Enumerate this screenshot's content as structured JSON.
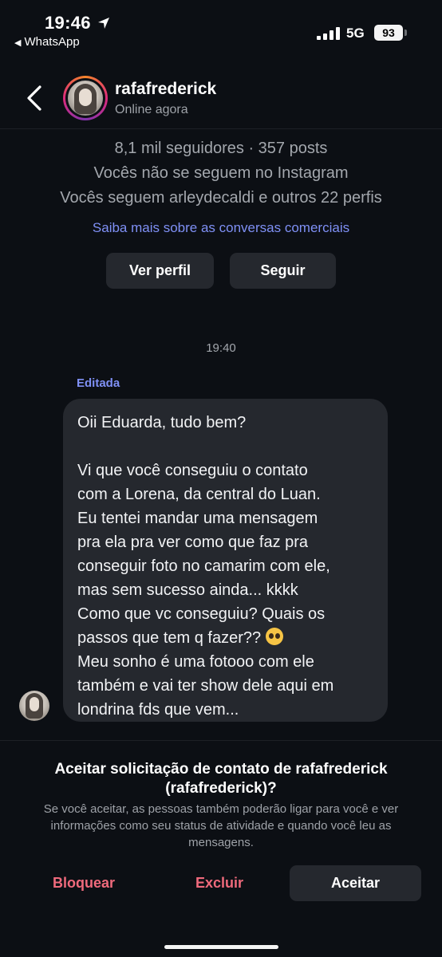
{
  "status_bar": {
    "time": "19:46",
    "back_app": "WhatsApp",
    "network": "5G",
    "battery": "93"
  },
  "header": {
    "username": "rafafrederick",
    "presence": "Online agora"
  },
  "profile_info": {
    "stats": "8,1 mil seguidores · 357 posts",
    "follow_status": "Vocês não se seguem no Instagram",
    "mutuals": "Vocês seguem arleydecaldi e outros 22 perfis",
    "learn_more": "Saiba mais sobre as conversas comerciais",
    "view_profile_label": "Ver perfil",
    "follow_label": "Seguir"
  },
  "conversation": {
    "timestamp": "19:40",
    "edited_label": "Editada",
    "message_part1": "Oii Eduarda, tudo bem?\n\nVi que você conseguiu o contato\ncom a Lorena, da central do Luan.\nEu tentei mandar uma mensagem\npra ela pra ver como que faz pra\nconseguir foto no camarim com ele,\nmas sem sucesso ainda... kkkk\nComo que vc conseguiu? Quais os\npassos que tem q fazer?? ",
    "message_part2": "\nMeu sonho é uma fotooo com ele\ntambém e vai ter show dele aqui em\nlondrina fds que vem..."
  },
  "request_panel": {
    "title": "Aceitar solicitação de contato de rafafrederick (rafafrederick)?",
    "description": "Se você aceitar, as pessoas também poderão ligar para você e ver informações como seu status de atividade e quando você leu as mensagens.",
    "block_label": "Bloquear",
    "delete_label": "Excluir",
    "accept_label": "Aceitar"
  },
  "colors": {
    "background": "#0c0f14",
    "bubble": "#25282e",
    "link": "#7f90f5",
    "danger": "#ef6a7c"
  }
}
